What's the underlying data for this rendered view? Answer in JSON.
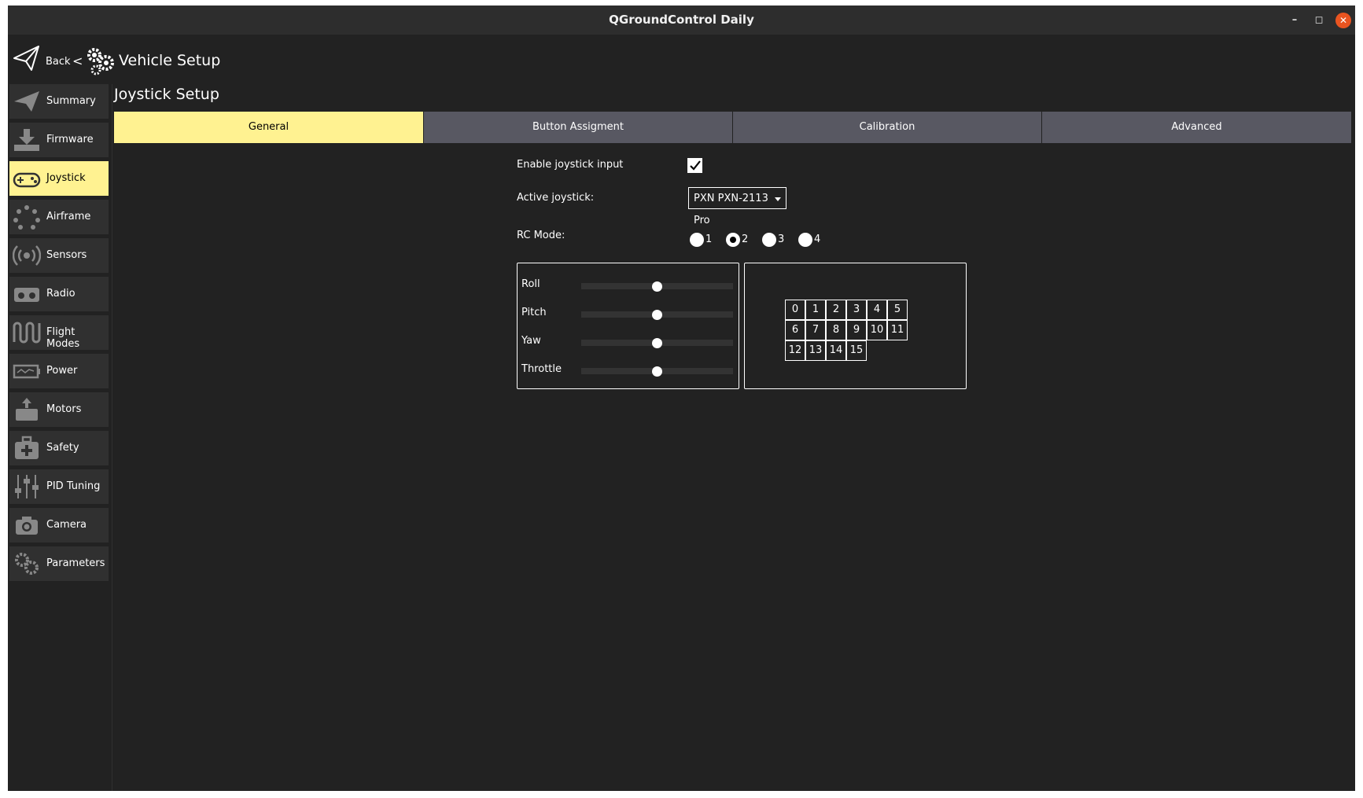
{
  "window": {
    "title": "QGroundControl Daily"
  },
  "header": {
    "back_label": "Back",
    "separator": "<",
    "title": "Vehicle Setup"
  },
  "sidebar": {
    "items": [
      {
        "label": "Summary",
        "icon": "paper-plane-icon",
        "active": false
      },
      {
        "label": "Firmware",
        "icon": "download-icon",
        "active": false
      },
      {
        "label": "Joystick",
        "icon": "gamepad-icon",
        "active": true
      },
      {
        "label": "Airframe",
        "icon": "airframe-icon",
        "active": false
      },
      {
        "label": "Sensors",
        "icon": "sensors-icon",
        "active": false
      },
      {
        "label": "Radio",
        "icon": "radio-icon",
        "active": false
      },
      {
        "label": "Flight Modes",
        "icon": "flight-modes-icon",
        "active": false
      },
      {
        "label": "Power",
        "icon": "battery-icon",
        "active": false
      },
      {
        "label": "Motors",
        "icon": "motors-icon",
        "active": false
      },
      {
        "label": "Safety",
        "icon": "safety-kit-icon",
        "active": false
      },
      {
        "label": "PID Tuning",
        "icon": "sliders-icon",
        "active": false
      },
      {
        "label": "Camera",
        "icon": "camera-icon",
        "active": false
      },
      {
        "label": "Parameters",
        "icon": "gears-icon",
        "active": false
      }
    ]
  },
  "main": {
    "title": "Joystick Setup",
    "tabs": [
      {
        "label": "General",
        "active": true
      },
      {
        "label": "Button Assigment",
        "active": false
      },
      {
        "label": "Calibration",
        "active": false
      },
      {
        "label": "Advanced",
        "active": false
      }
    ],
    "enable_label": "Enable joystick input",
    "enable_checked": true,
    "active_joystick_label": "Active joystick:",
    "active_joystick_value": "PXN PXN-2113 Pro",
    "rc_mode_label": "RC Mode:",
    "rc_modes": [
      "1",
      "2",
      "3",
      "4"
    ],
    "rc_mode_selected": "2",
    "axes": [
      {
        "label": "Roll",
        "value": 0.5
      },
      {
        "label": "Pitch",
        "value": 0.5
      },
      {
        "label": "Yaw",
        "value": 0.5
      },
      {
        "label": "Throttle",
        "value": 0.5
      }
    ],
    "buttons": [
      "0",
      "1",
      "2",
      "3",
      "4",
      "5",
      "6",
      "7",
      "8",
      "9",
      "10",
      "11",
      "12",
      "13",
      "14",
      "15"
    ]
  },
  "colors": {
    "accent": "#fff291",
    "background": "#222222",
    "tab": "#585862",
    "sidebar_item": "#303030"
  }
}
